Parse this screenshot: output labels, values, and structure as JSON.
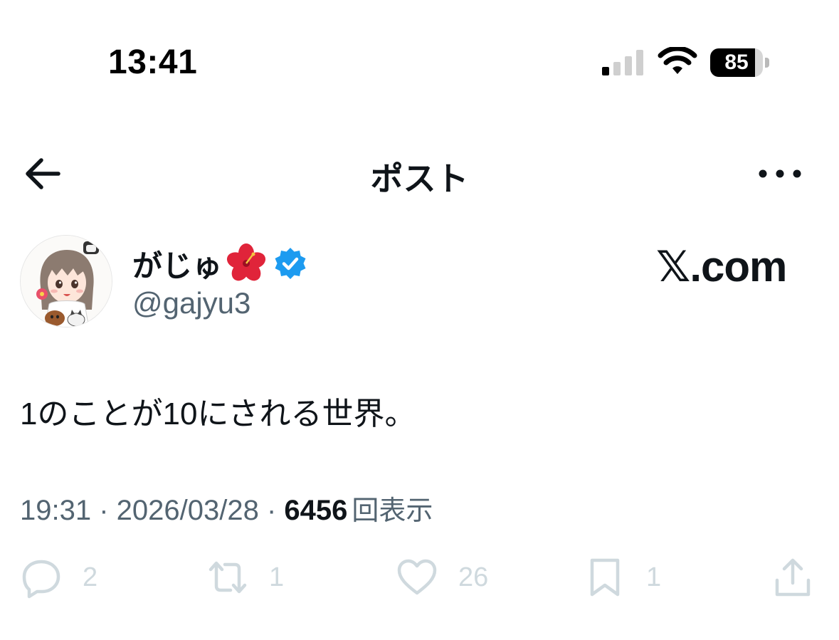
{
  "status_bar": {
    "time": "13:41",
    "battery_percent": "85",
    "battery_level": 0.85,
    "signal_bars_active": 1,
    "signal_bars_total": 4,
    "icons": [
      "cellular-signal-icon",
      "wifi-icon",
      "battery-icon"
    ]
  },
  "nav": {
    "title": "ポスト",
    "back_icon": "arrow-left-icon",
    "more_icon": "more-horizontal-icon"
  },
  "author": {
    "display_name": "がじゅ",
    "handle": "@gajyu3",
    "name_emoji": "hibiscus-icon",
    "verified": true,
    "verified_color": "#1d9bf0"
  },
  "source_label": "𝕏.com",
  "post": {
    "text": "1のことが10にされる世界。",
    "time": "19:31",
    "separator": " · ",
    "date": "2026/03/28",
    "views_count": "6456",
    "views_label": "回表示"
  },
  "actions": {
    "replies": "2",
    "reposts": "1",
    "likes": "26",
    "bookmarks": "1",
    "icon_color": "#cfd9de"
  }
}
